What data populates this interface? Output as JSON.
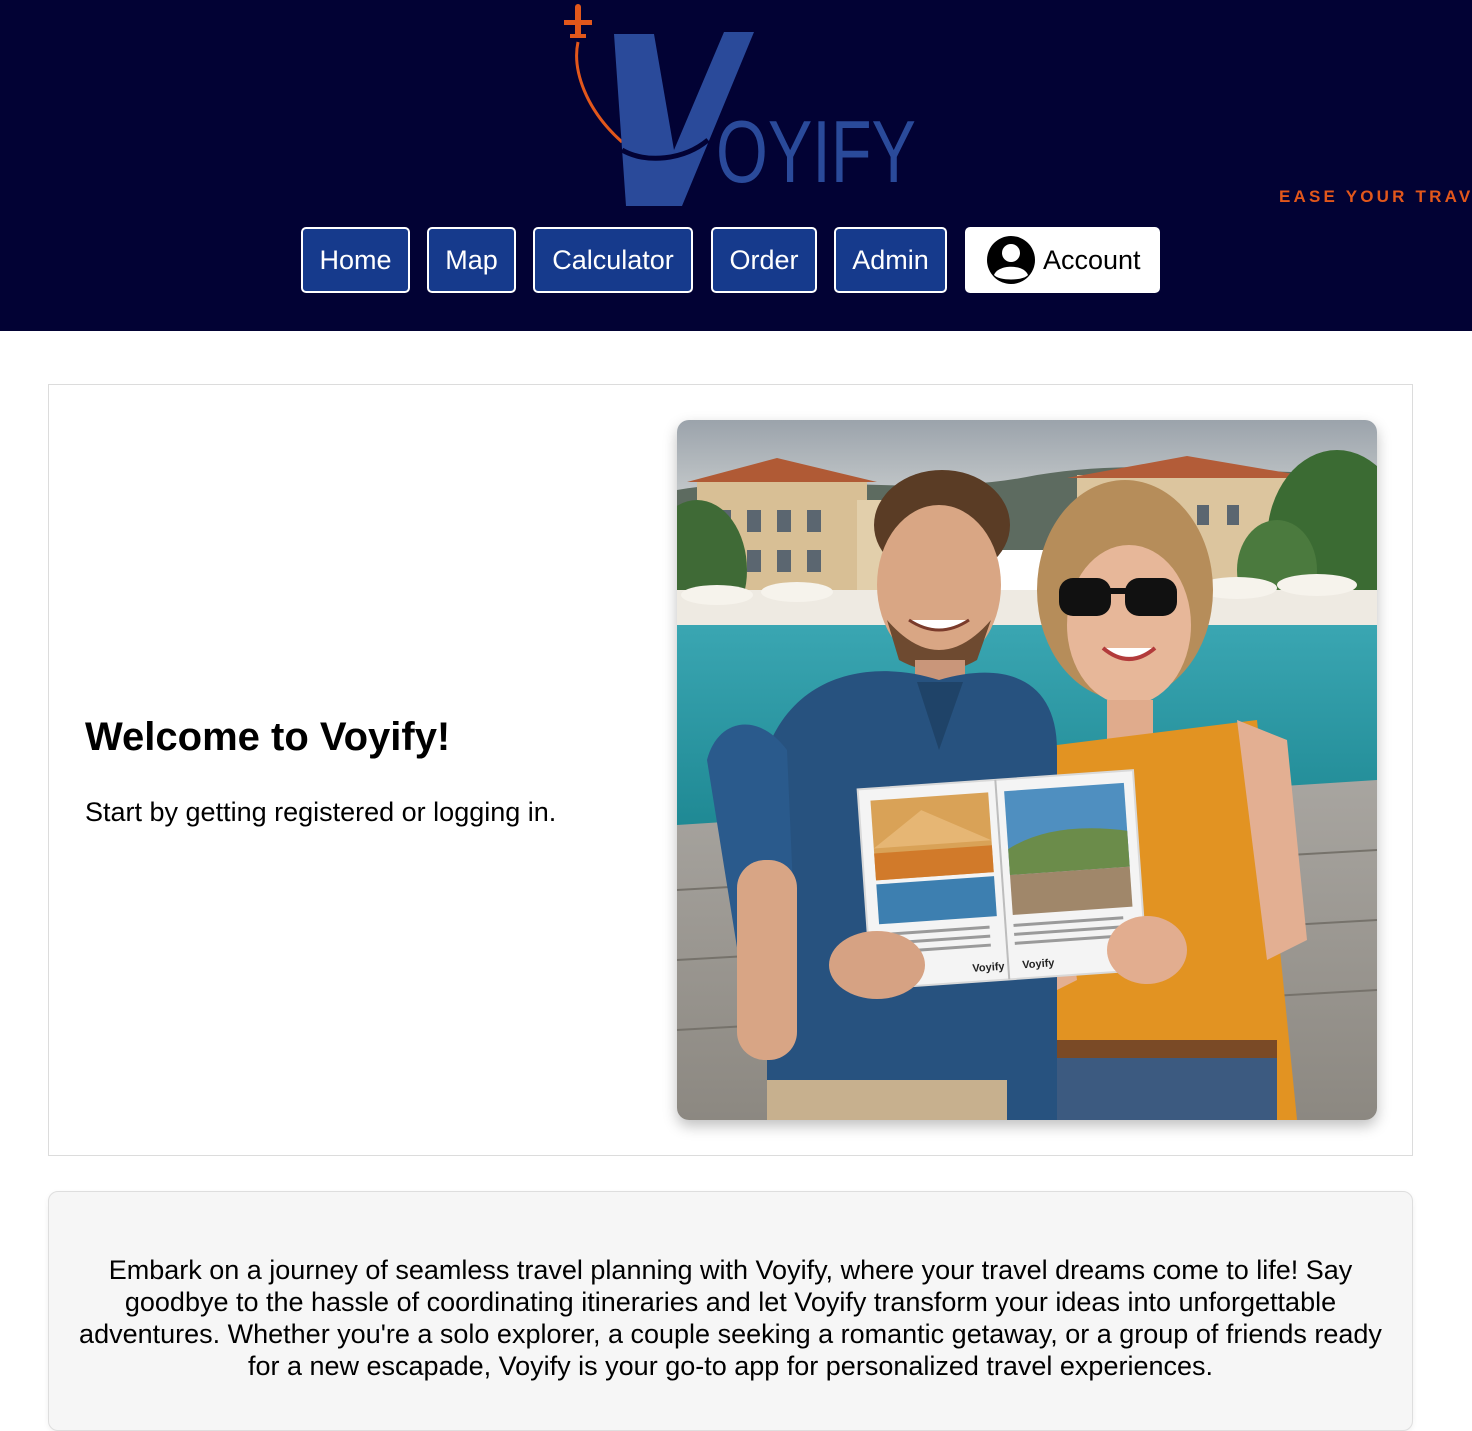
{
  "brand": {
    "logo_text": "VOYIFY",
    "tagline": "EASE YOUR TRAVEL",
    "colors": {
      "header_bg": "#020234",
      "logo_blue": "#2a4a9a",
      "accent_orange": "#e2571b",
      "nav_button_bg": "#163a8c"
    }
  },
  "nav": {
    "home": "Home",
    "map": "Map",
    "calculator": "Calculator",
    "order": "Order",
    "admin": "Admin",
    "account": "Account",
    "account_icon": "user-circle-icon"
  },
  "hero": {
    "title": "Welcome to Voyify!",
    "subtitle": "Start by getting registered or logging in.",
    "brochure_brand": "Voyify"
  },
  "about": {
    "text": "Embark on a journey of seamless travel planning with Voyify, where your travel dreams come to life! Say goodbye to the hassle of coordinating itineraries and let Voyify transform your ideas into unforgettable adventures. Whether you're a solo explorer, a couple seeking a romantic getaway, or a group of friends ready for a new escapade, Voyify is your go-to app for personalized travel experiences."
  }
}
